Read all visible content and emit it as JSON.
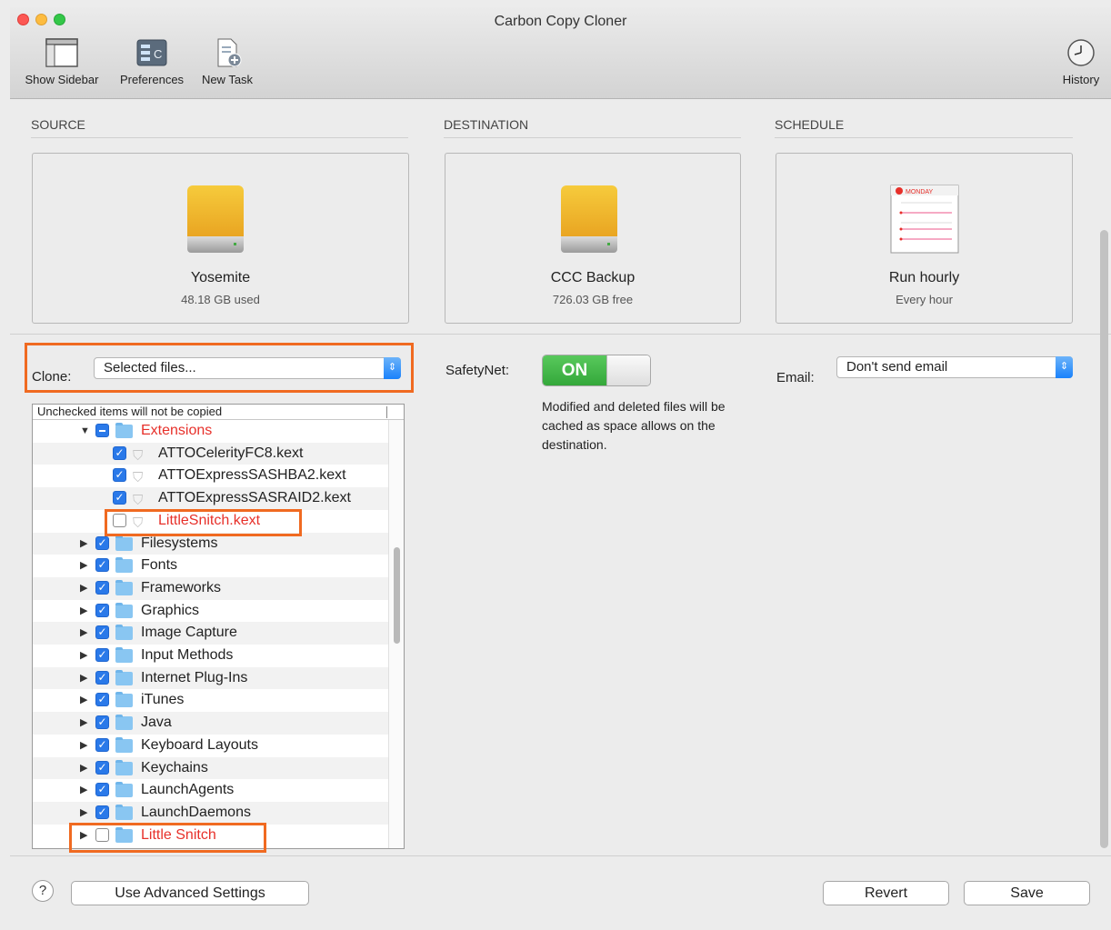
{
  "window": {
    "title": "Carbon Copy Cloner"
  },
  "toolbar": {
    "show_sidebar": "Show Sidebar",
    "preferences": "Preferences",
    "new_task": "New Task",
    "history": "History"
  },
  "source": {
    "header": "SOURCE",
    "name": "Yosemite",
    "detail": "48.18 GB used"
  },
  "destination": {
    "header": "DESTINATION",
    "name": "CCC Backup",
    "detail": "726.03 GB free"
  },
  "schedule": {
    "header": "SCHEDULE",
    "name": "Run hourly",
    "detail": "Every hour",
    "calendar_day": "MONDAY"
  },
  "clone": {
    "label": "Clone:",
    "value": "Selected files..."
  },
  "safetynet": {
    "label": "SafetyNet:",
    "state": "ON",
    "description": "Modified and deleted files will be cached as space allows on the destination."
  },
  "email": {
    "label": "Email:",
    "value": "Don't send email"
  },
  "tree": {
    "header": "Unchecked items will not be copied",
    "rows": [
      {
        "label": "Extensions",
        "state": "mixed",
        "type": "folder",
        "expanded": true,
        "excluded": true
      },
      {
        "label": "ATTOCelerityFC8.kext",
        "state": "checked",
        "type": "kext"
      },
      {
        "label": "ATTOExpressSASHBA2.kext",
        "state": "checked",
        "type": "kext"
      },
      {
        "label": "ATTOExpressSASRAID2.kext",
        "state": "checked",
        "type": "kext"
      },
      {
        "label": "LittleSnitch.kext",
        "state": "unchecked",
        "type": "kext",
        "excluded": true
      },
      {
        "label": "Filesystems",
        "state": "checked",
        "type": "folder"
      },
      {
        "label": "Fonts",
        "state": "checked",
        "type": "folder"
      },
      {
        "label": "Frameworks",
        "state": "checked",
        "type": "folder"
      },
      {
        "label": "Graphics",
        "state": "checked",
        "type": "folder"
      },
      {
        "label": "Image Capture",
        "state": "checked",
        "type": "folder"
      },
      {
        "label": "Input Methods",
        "state": "checked",
        "type": "folder"
      },
      {
        "label": "Internet Plug-Ins",
        "state": "checked",
        "type": "folder"
      },
      {
        "label": "iTunes",
        "state": "checked",
        "type": "folder"
      },
      {
        "label": "Java",
        "state": "checked",
        "type": "folder"
      },
      {
        "label": "Keyboard Layouts",
        "state": "checked",
        "type": "folder"
      },
      {
        "label": "Keychains",
        "state": "checked",
        "type": "folder"
      },
      {
        "label": "LaunchAgents",
        "state": "checked",
        "type": "folder"
      },
      {
        "label": "LaunchDaemons",
        "state": "checked",
        "type": "folder"
      },
      {
        "label": "Little Snitch",
        "state": "unchecked",
        "type": "folder",
        "excluded": true
      }
    ]
  },
  "footer": {
    "help": "?",
    "advanced": "Use Advanced Settings",
    "revert": "Revert",
    "save": "Save"
  },
  "colors": {
    "highlight": "#f06a21",
    "excluded_text": "#e7302a",
    "toggle_on": "#34a83a",
    "accent": "#1a82fb"
  }
}
